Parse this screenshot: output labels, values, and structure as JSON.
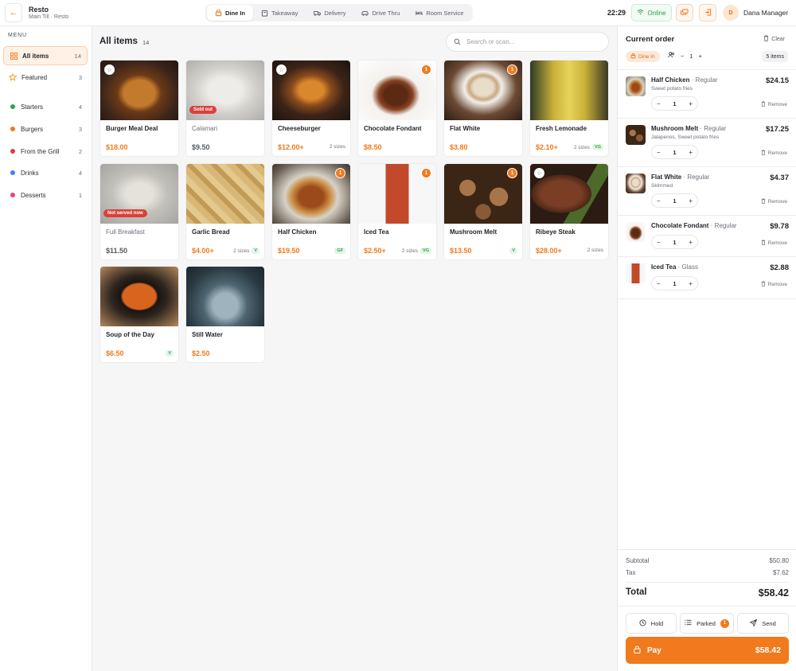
{
  "app": {
    "name": "Resto",
    "location": "Main Till · Resto"
  },
  "modes": [
    {
      "label": "Dine In",
      "icon": "dine-in-icon",
      "active": true
    },
    {
      "label": "Takeaway",
      "icon": "bag-icon",
      "active": false
    },
    {
      "label": "Delivery",
      "icon": "truck-icon",
      "active": false
    },
    {
      "label": "Drive Thru",
      "icon": "car-icon",
      "active": false
    },
    {
      "label": "Room Service",
      "icon": "bed-icon",
      "active": false
    }
  ],
  "topbar": {
    "time": "22:29",
    "online_label": "Online",
    "user_initial": "D",
    "user_name": "Dana Manager"
  },
  "sidebar": {
    "title": "MENU",
    "items": [
      {
        "label": "All items",
        "count": "14",
        "icon": "grid-icon"
      },
      {
        "label": "Featured",
        "count": "3",
        "icon": "star-icon"
      },
      {
        "label": "Starters",
        "count": "4",
        "color": "#2fa150"
      },
      {
        "label": "Burgers",
        "count": "3",
        "color": "#f07a1d"
      },
      {
        "label": "From the Grill",
        "count": "2",
        "color": "#d9413a"
      },
      {
        "label": "Drinks",
        "count": "4",
        "color": "#3b82f6"
      },
      {
        "label": "Desserts",
        "count": "1",
        "color": "#e8457c"
      }
    ]
  },
  "main": {
    "title": "All items",
    "count": "14",
    "search_placeholder": "Search or scan..."
  },
  "products": [
    {
      "name": "Burger Meal Deal",
      "price": "$18.00"
    },
    {
      "name": "Calamari",
      "price": "$9.50",
      "status": "Sold out"
    },
    {
      "name": "Cheeseburger",
      "price": "$12.00+",
      "sizes": "2 sizes"
    },
    {
      "name": "Chocolate Fondant",
      "price": "$8.50",
      "qty": "1"
    },
    {
      "name": "Flat White",
      "price": "$3.80",
      "qty": "1"
    },
    {
      "name": "Fresh Lemonade",
      "price": "$2.10+",
      "sizes": "2 sizes",
      "tag": "VG"
    },
    {
      "name": "Full Breakfast",
      "price": "$11.50",
      "status": "Not served now"
    },
    {
      "name": "Garlic Bread",
      "price": "$4.00+",
      "sizes": "2 sizes",
      "tag": "V"
    },
    {
      "name": "Half Chicken",
      "price": "$19.50",
      "tag": "GF",
      "qty": "1"
    },
    {
      "name": "Iced Tea",
      "price": "$2.50+",
      "sizes": "2 sizes",
      "tag": "VG",
      "qty": "1"
    },
    {
      "name": "Mushroom Melt",
      "price": "$13.50",
      "tag": "V",
      "qty": "1"
    },
    {
      "name": "Ribeye Steak",
      "price": "$28.00+",
      "sizes": "2 sizes"
    },
    {
      "name": "Soup of the Day",
      "price": "$6.50",
      "tag": "V"
    },
    {
      "name": "Still Water",
      "price": "$2.50"
    }
  ],
  "order": {
    "title": "Current order",
    "clear_label": "Clear",
    "mode_label": "Dine In",
    "guests": "1",
    "items_count": "5 items",
    "lines": [
      {
        "name": "Half Chicken",
        "variant": " · Regular",
        "modifiers": "Sweet potato fries",
        "price": "$24.15",
        "qty": "1"
      },
      {
        "name": "Mushroom Melt",
        "variant": " · Regular",
        "modifiers": "Jalapenos, Sweet potato fries",
        "price": "$17.25",
        "qty": "1"
      },
      {
        "name": "Flat White",
        "variant": " · Regular",
        "modifiers": "Skimmed",
        "price": "$4.37",
        "qty": "1"
      },
      {
        "name": "Chocolate Fondant",
        "variant": " · Regular",
        "modifiers": "",
        "price": "$9.78",
        "qty": "1"
      },
      {
        "name": "Iced Tea",
        "variant": " · Glass",
        "modifiers": "",
        "price": "$2.88",
        "qty": "1"
      }
    ],
    "remove_label": "Remove",
    "subtotal_label": "Subtotal",
    "subtotal": "$50.80",
    "tax_label": "Tax",
    "tax": "$7.62",
    "total_label": "Total",
    "total": "$58.42",
    "hold_label": "Hold",
    "parked_label": "Parked",
    "parked_count": "1",
    "send_label": "Send",
    "pay_label": "Pay",
    "pay_amount": "$58.42"
  },
  "colors": {
    "accent": "#f07a1d",
    "online": "#2fa150",
    "danger": "#d9413a"
  }
}
